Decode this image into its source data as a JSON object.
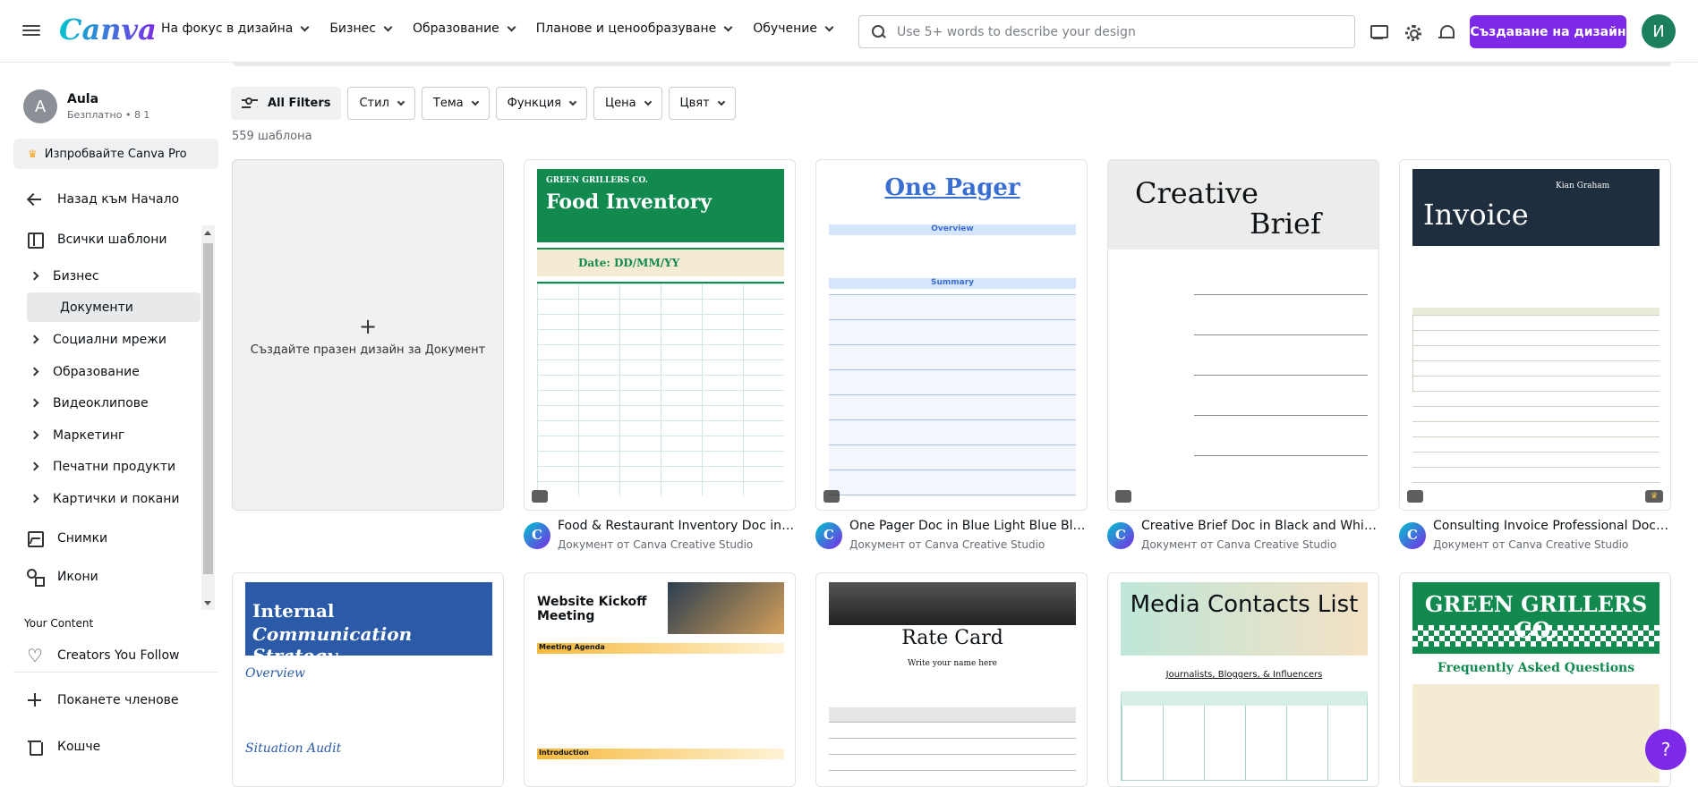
{
  "header": {
    "logo": "Canva",
    "nav": [
      "На фокус в дизайна",
      "Бизнес",
      "Образование",
      "Планове и ценообразуване",
      "Обучение"
    ],
    "search_placeholder": "Use 5+ words to describe your design",
    "create_button": "Създаване на дизайн",
    "user_initial": "И"
  },
  "sidebar": {
    "account_initial": "A",
    "account_name": "Aula",
    "account_plan": "Безплатно • 8 1",
    "pro_button": "Изпробвайте Canva Pro",
    "back_link": "Назад към Начало",
    "all_templates": "Всички шаблони",
    "tree": [
      {
        "label": "Бизнес",
        "active": false
      },
      {
        "label": "Документи",
        "active": true
      },
      {
        "label": "Социални мрежи",
        "active": false
      },
      {
        "label": "Образование",
        "active": false
      },
      {
        "label": "Видеоклипове",
        "active": false
      },
      {
        "label": "Маркетинг",
        "active": false
      },
      {
        "label": "Печатни продукти",
        "active": false
      },
      {
        "label": "Картички и покани",
        "active": false
      }
    ],
    "photos": "Снимки",
    "icons": "Икони",
    "your_content_label": "Your Content",
    "creators": "Creators You Follow",
    "invite": "Поканете членове",
    "trash": "Кошче"
  },
  "filters": {
    "all": "All Filters",
    "items": [
      "Стил",
      "Тема",
      "Функция",
      "Цена",
      "Цвят"
    ]
  },
  "template_count": "559 шаблона",
  "blank_card": {
    "plus": "+",
    "label": "Създайте празен дизайн за Документ"
  },
  "cards": [
    {
      "title": "Food & Restaurant Inventory Doc in Green Cream Warm Classic Style",
      "sub": "Документ от Canva Creative Studio",
      "pro": false
    },
    {
      "title": "One Pager Doc in Blue Light Blue Black Simple Style",
      "sub": "Документ от Canva Creative Studio",
      "pro": false
    },
    {
      "title": "Creative Brief Doc in Black and White Grey Simple Style",
      "sub": "Документ от Canva Creative Studio",
      "pro": false
    },
    {
      "title": "Consulting Invoice Professional Doc in Dark Blue",
      "sub": "Документ от Canva Creative Studio",
      "pro": true
    }
  ],
  "thumbs": {
    "food_small": "GREEN GRILLERS CO.",
    "food_big": "Food Inventory",
    "food_date": "Date: DD/MM/YY",
    "pager_title": "One Pager",
    "pager_overview": "Overview",
    "pager_summary": "Summary",
    "brief_1": "Creative",
    "brief_2": "Brief",
    "invoice_title": "Invoice",
    "invoice_name": "Kian Graham",
    "ics_1": "Internal",
    "ics_2": "Communication Strategy",
    "ics_h1": "Overview",
    "ics_h2": "Situation Audit",
    "wk_title": "Website Kickoff Meeting",
    "wk_agenda": "Meeting Agenda",
    "wk_intro": "Introduction",
    "rc_title": "Rate Card",
    "rc_name": "Write your name here",
    "mc_title": "Media Contacts List",
    "mc_sub": "Journalists, Bloggers, & Influencers",
    "gg_title": "GREEN GRILLERS CO.",
    "gg_sub": "Frequently Asked Questions"
  },
  "help": "?",
  "colors": {
    "brand": "#7d2ae8",
    "green": "#128a4f",
    "blue": "#2b5ba8"
  }
}
